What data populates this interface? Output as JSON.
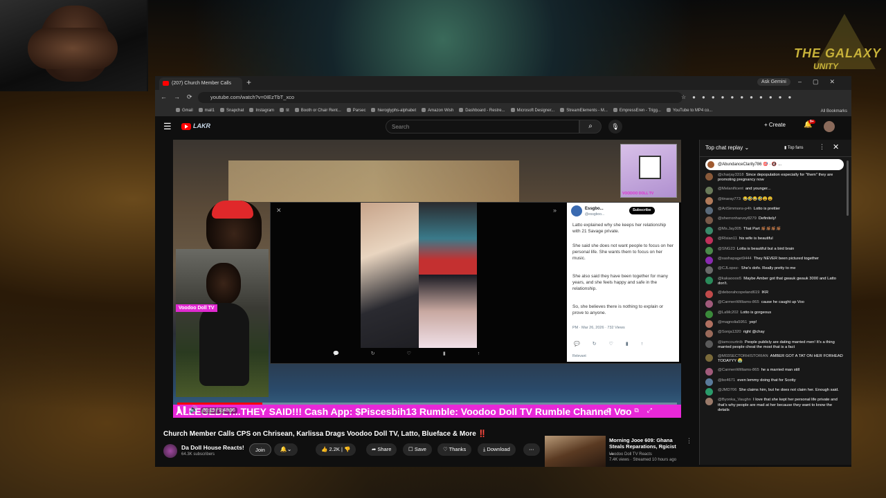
{
  "browser": {
    "tab_title": "(207) Church Member Calls",
    "gemini": "Ask Gemini",
    "url": "youtube.com/watch?v=0IEzTbT_xco",
    "bookmarks": [
      "Gmail",
      "mail1",
      "Snapchat",
      "Instagram",
      "tit",
      "Booth or Chair Rent...",
      "Parsec",
      "hieroglyphs-alphabet",
      "Amazon Wish",
      "Dashboard - Restre...",
      "Microsoft Designer...",
      "StreamElements - M...",
      "EmpressEren - Trigg...",
      "YouTube to MP4 co..."
    ],
    "all_bookmarks": "All Bookmarks"
  },
  "youtube": {
    "search_placeholder": "Search",
    "create_label": "Create",
    "notif_count": "9+"
  },
  "video": {
    "ticker": "ALLEGEDLY...THEY SAID!!! Cash App: $Piscesbih13 Rumble: Voodoo Doll TV Rumble Channel Voo",
    "time": "30:19 / 2:48:56",
    "progress": 0.17,
    "label_voodoo": "Voodoo Doll TV",
    "channel_img_label": "VOODOO DOLL TV",
    "tweet": {
      "name": "Essgbo...",
      "handle": "@essgboo...",
      "subscribe": "Subscribe",
      "p1": "Latto explained why she keeps her relationship with 21 Savage private.",
      "p2": "She said she does not want people to focus on her personal life. She wants them to focus on her music.",
      "p3": "She also said they have been together for many years, and she feels happy and safe in the relationship.",
      "p4": "So, she believes there is nothing to explain or prove to anyone.",
      "date": "PM · Mar 26, 2026 · 732 Views",
      "relevant": "Relevant"
    }
  },
  "meta": {
    "title": "Church Member Calls CPS on Chrisean, Karlissa Drags Voodoo Doll TV, Latto, Blueface & More ‼️",
    "channel": "Da Doll House Reacts!",
    "subs": "64.3K subscribers",
    "join": "Join",
    "likes": "2.2K",
    "share": "Share",
    "save": "Save",
    "thanks": "Thanks",
    "download": "Download"
  },
  "reco": {
    "title": "Morning Jooe 609: Ghana Steals Reparations, Rgicist ...",
    "channel": "Voodoo Doll TV Reacts",
    "views": "7.4K views · Streamed 10 hours ago"
  },
  "chat": {
    "header": "Top chat replay",
    "top_fans": "Top fans",
    "pinned": "@AbundanceClarity786 🎯 · 🔇 ...",
    "messages": [
      {
        "author": "@charjay3318",
        "text": "Since depopulation especially for \"them\" they are promoting pregnancy now",
        "color": "#8a5a3a"
      },
      {
        "author": "@Melanificent",
        "text": "and younger...",
        "color": "#6a7a5a"
      },
      {
        "author": "@tinaray773",
        "text": "😂🤣😂🤣😩😩",
        "color": "#b07a5a"
      },
      {
        "author": "@AriSimmons-p4h",
        "text": "Lotto is prettier",
        "color": "#5a6a7a"
      },
      {
        "author": "@sherronharvey8279",
        "text": "Definitely!",
        "color": "#7a5a4a"
      },
      {
        "author": "@Ms.Jay305",
        "text": "That Part 👏🏾👏🏾👏🏾👏🏾",
        "color": "#3a8a6a"
      },
      {
        "author": "@Rlsian11",
        "text": "his wife is beautiful",
        "color": "#c0305a"
      },
      {
        "author": "@SNG23",
        "text": "Lotta is beautiful but a bird brain",
        "color": "#4a8a4a"
      },
      {
        "author": "@sashapaget9444",
        "text": "They NEVER been pictured together",
        "color": "#8a2ab0"
      },
      {
        "author": "@CJLopez-",
        "text": "She's dofo. Really pretty to me",
        "color": "#6a6a6a"
      },
      {
        "author": "@kakaoooo5",
        "text": "Maybe Amber got that gwauk gwauk 3000 and Latto don't.",
        "color": "#2a8a5a"
      },
      {
        "author": "@deborahcopeland619",
        "text": "IKR",
        "color": "#c04a4a"
      },
      {
        "author": "@CarmenWilliams-865",
        "text": "cause he caught up Voo",
        "color": "#a05a7a"
      },
      {
        "author": "@LaMc202",
        "text": "Lotto is gorgeous",
        "color": "#3a8a3a"
      },
      {
        "author": "@magnolia5951",
        "text": "yep!",
        "color": "#b07060"
      },
      {
        "author": "@Sonja1320",
        "text": "right @chay",
        "color": "#9a6a5a"
      },
      {
        "author": "@iamcourtnib",
        "text": "People publicly are dating married men! It's a thing married people cheat the most that is a fact",
        "color": "#5a5a5a"
      },
      {
        "author": "@M03SECTORHISTORIAN",
        "text": "AMBER GOT A TAT ON HER FORHEAD TODAYYY 😭",
        "color": "#7a6a3a"
      },
      {
        "author": "@CarmenWilliams-865",
        "text": "he a married man still",
        "color": "#a05a7a"
      },
      {
        "author": "@bo4671",
        "text": "even lemmy doing that for Scotty",
        "color": "#5a7a9a"
      },
      {
        "author": "@JMD706",
        "text": "She claims him, but he does not claim her. Enough said.",
        "color": "#2a9a6a"
      },
      {
        "author": "@Byonka_Vaughn",
        "text": "I love that she kept her personal life private and that's why people are mad at her because they want to know the details",
        "color": "#9a7a6a"
      }
    ]
  },
  "overlay_logo": {
    "line1": "THE GALAXY",
    "line2": "UNITY"
  }
}
